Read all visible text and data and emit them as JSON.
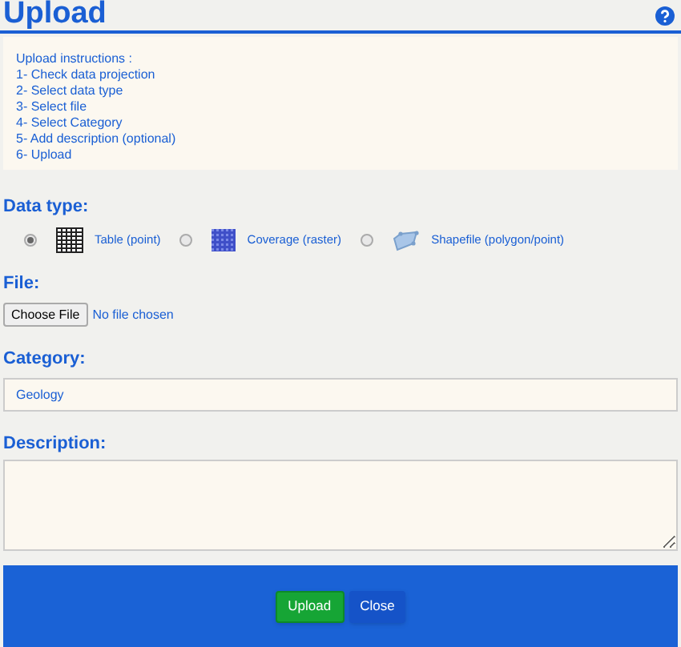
{
  "title": "Upload",
  "instructions": {
    "heading": "Upload instructions :",
    "steps": [
      "1- Check data projection",
      "2- Select data type",
      "3- Select file",
      "4- Select Category",
      "5- Add description (optional)",
      "6- Upload"
    ]
  },
  "data_type": {
    "label": "Data type:",
    "options": [
      {
        "kind": "table",
        "label": "Table (point)",
        "selected": true
      },
      {
        "kind": "coverage",
        "label": "Coverage (raster)",
        "selected": false
      },
      {
        "kind": "shapefile",
        "label": "Shapefile (polygon/point)",
        "selected": false
      }
    ]
  },
  "file": {
    "label": "File:",
    "button": "Choose File",
    "status": "No file chosen"
  },
  "category": {
    "label": "Category:",
    "value": "Geology"
  },
  "description": {
    "label": "Description:"
  },
  "buttons": [
    {
      "kind": "primary",
      "label": "Upload"
    },
    {
      "kind": "secondary",
      "label": "Close"
    }
  ]
}
